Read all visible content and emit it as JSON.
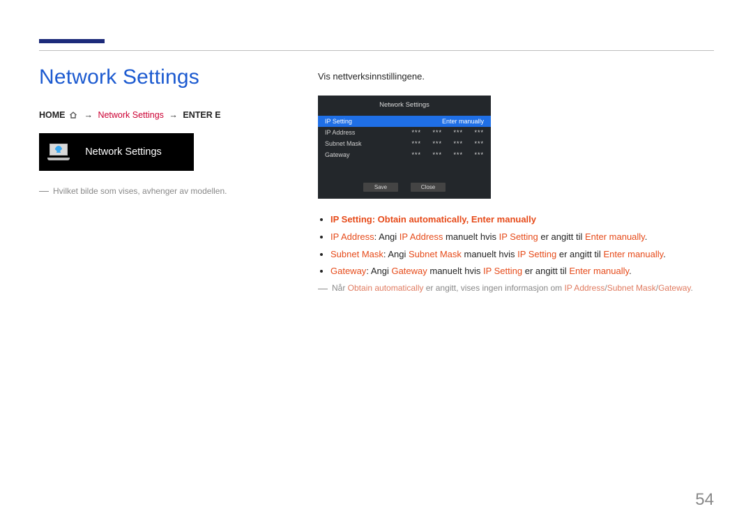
{
  "page_number": "54",
  "left": {
    "title": "Network Settings",
    "breadcrumb": {
      "home": "HOME",
      "middle": "Network Settings",
      "enter": "ENTER E",
      "arrow": "→"
    },
    "tile_label": "Network Settings",
    "footnote": "Hvilket bilde som vises, avhenger av modellen."
  },
  "right": {
    "intro": "Vis nettverksinnstillingene.",
    "osd": {
      "title": "Network Settings",
      "highlight": {
        "left": "IP Setting",
        "right": "Enter manually"
      },
      "rows": [
        {
          "k": "IP Address",
          "v": [
            "***",
            "***",
            "***",
            "***"
          ]
        },
        {
          "k": "Subnet Mask",
          "v": [
            "***",
            "***",
            "***",
            "***"
          ]
        },
        {
          "k": "Gateway",
          "v": [
            "***",
            "***",
            "***",
            "***"
          ]
        }
      ],
      "buttons": {
        "save": "Save",
        "close": "Close"
      }
    },
    "bullets": {
      "b0_1": "IP Setting",
      "b0_2": ": ",
      "b0_3": "Obtain automatically",
      "b0_4": ", ",
      "b0_5": "Enter manually",
      "b1_1": "IP Address",
      "b1_2": ": Angi ",
      "b1_3": "IP Address",
      "b1_4": " manuelt hvis ",
      "b1_5": "IP Setting",
      "b1_6": " er angitt til ",
      "b1_7": "Enter manually",
      "b1_8": ".",
      "b2_1": "Subnet Mask",
      "b2_2": ": Angi ",
      "b2_3": "Subnet Mask",
      "b2_4": " manuelt hvis ",
      "b2_5": "IP Setting",
      "b2_6": " er angitt til ",
      "b2_7": "Enter manually",
      "b2_8": ".",
      "b3_1": "Gateway",
      "b3_2": ": Angi ",
      "b3_3": "Gateway",
      "b3_4": " manuelt hvis ",
      "b3_5": "IP Setting",
      "b3_6": " er angitt til ",
      "b3_7": "Enter manually",
      "b3_8": "."
    },
    "note2": {
      "t1": "Når ",
      "t2": "Obtain automatically",
      "t3": " er angitt, vises ingen informasjon om ",
      "t4": "IP Address",
      "t5": "/",
      "t6": "Subnet Mask",
      "t7": "/",
      "t8": "Gateway",
      "t9": "."
    }
  }
}
